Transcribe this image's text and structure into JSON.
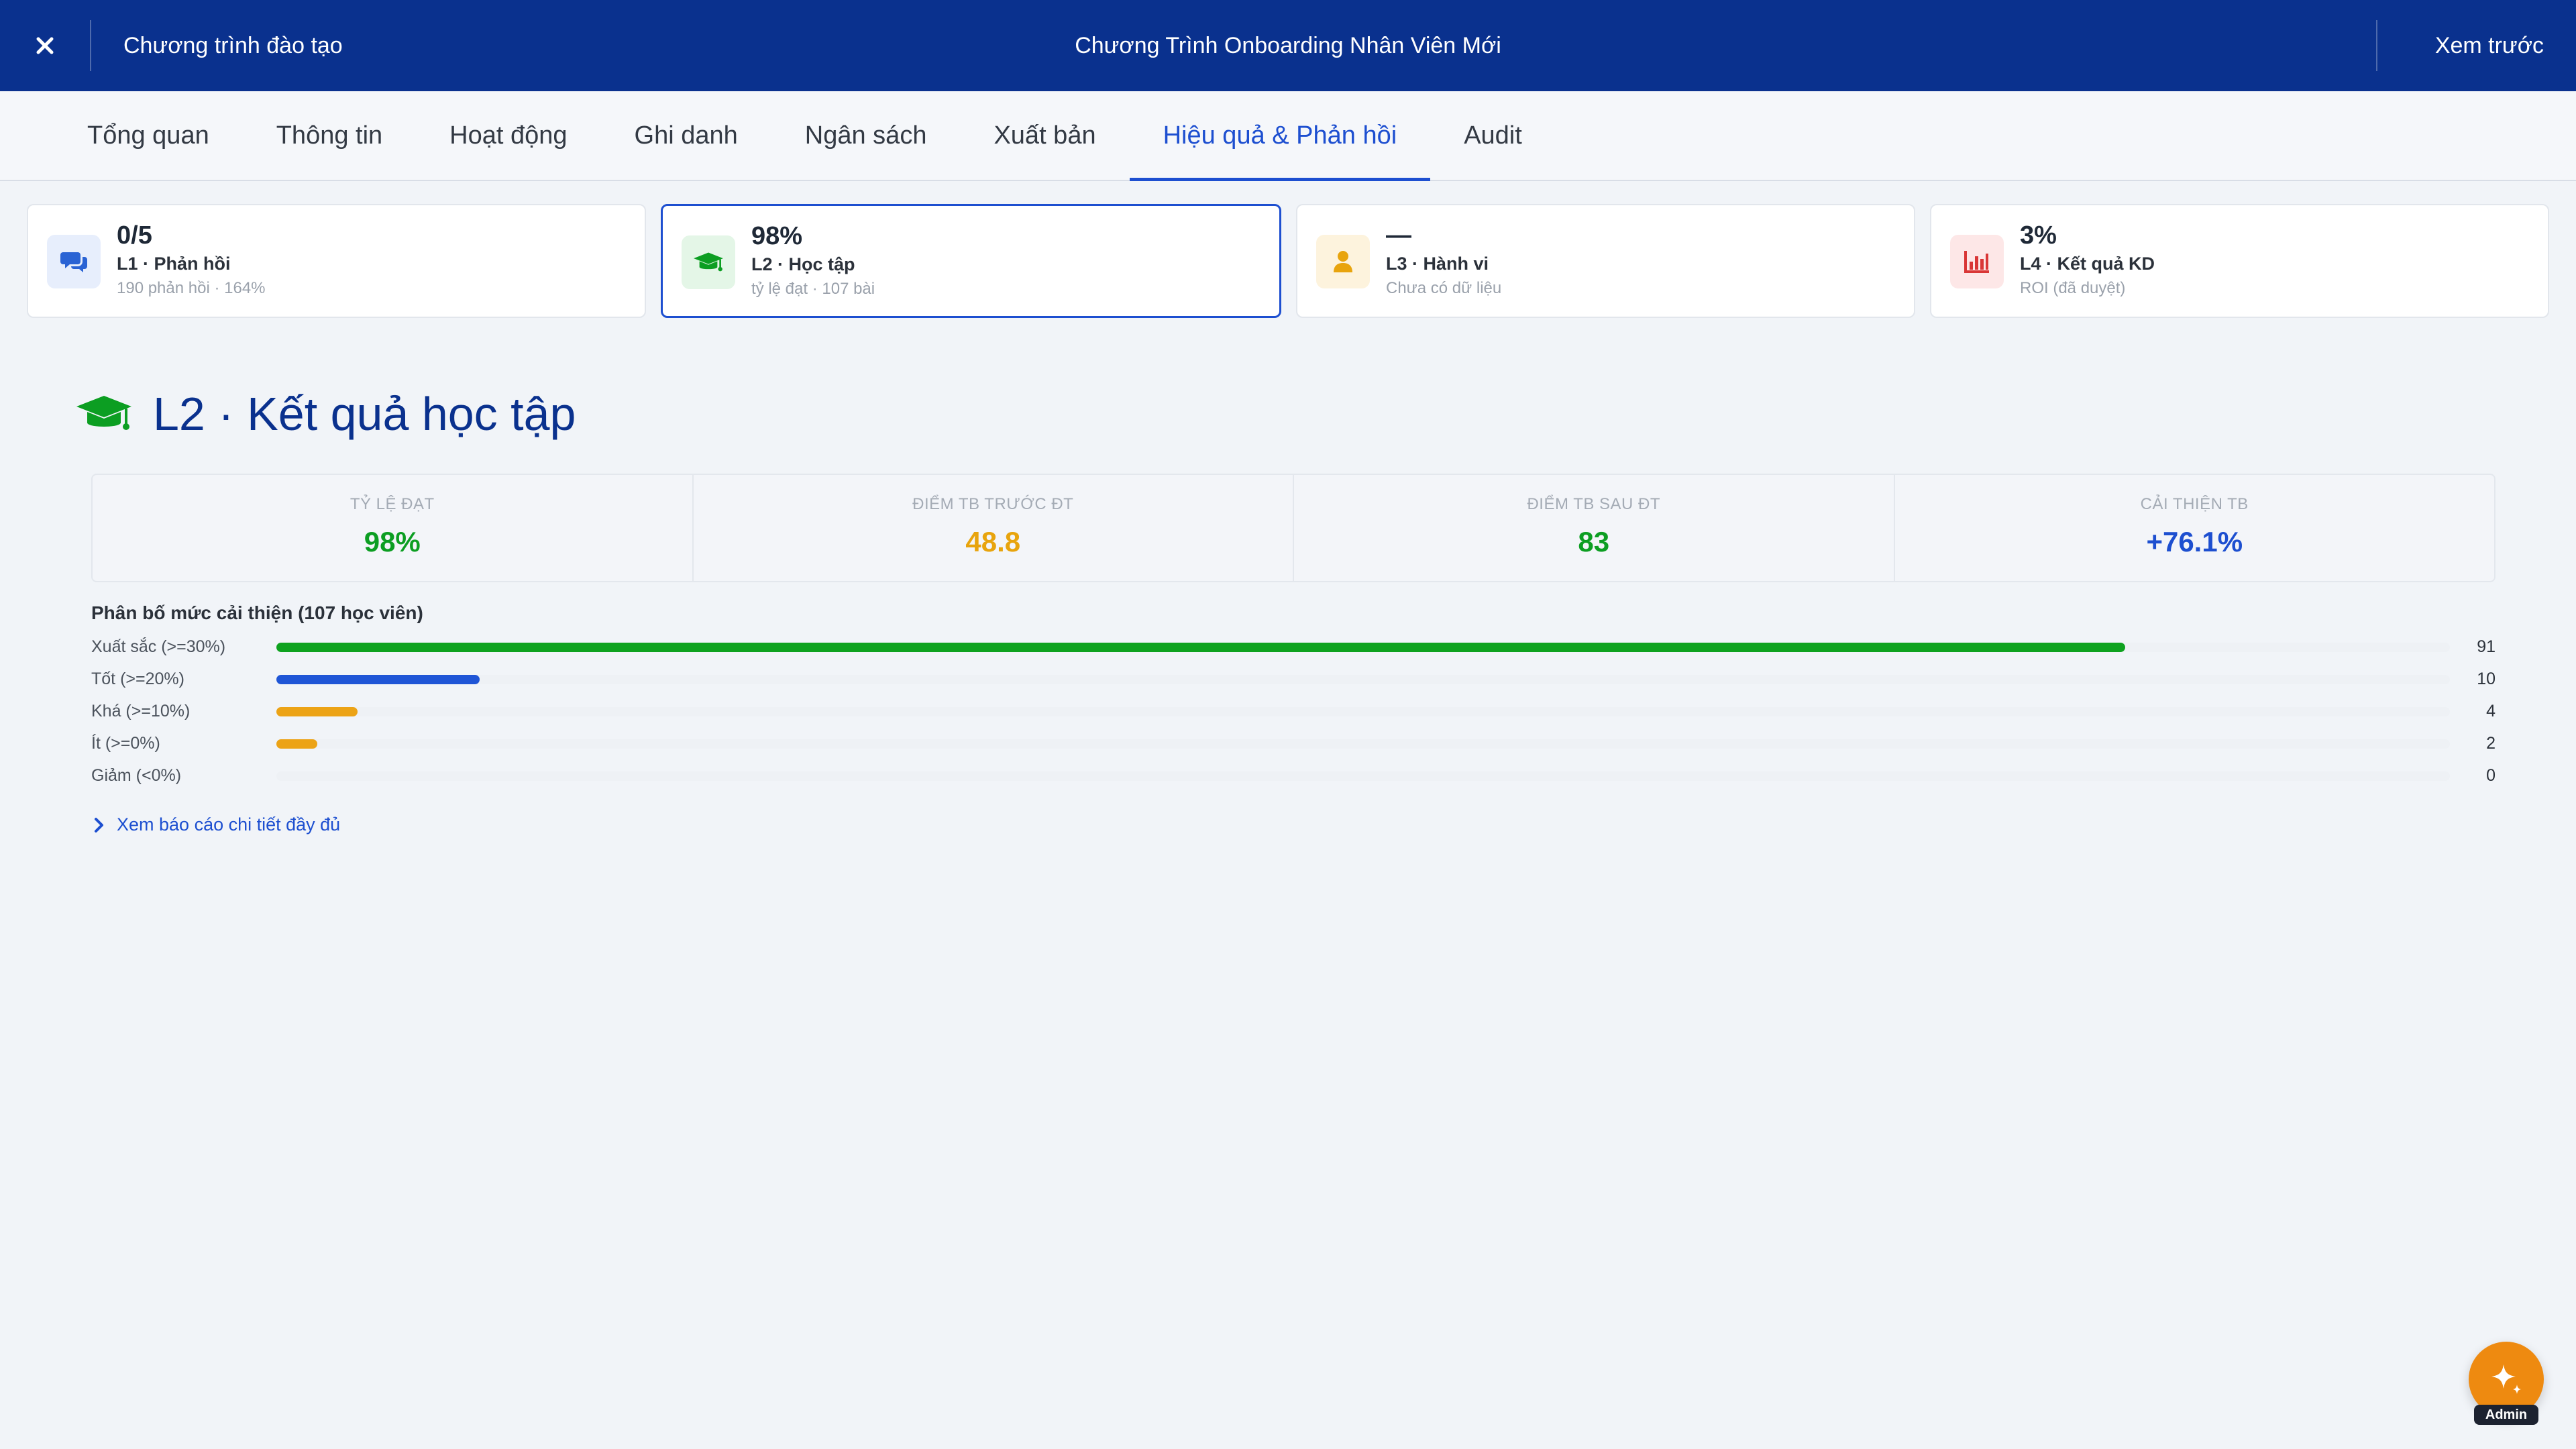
{
  "topbar": {
    "back_label": "Chương trình đào tạo",
    "title": "Chương Trình Onboarding Nhân Viên Mới",
    "preview_label": "Xem trước"
  },
  "tabs": [
    {
      "label": "Tổng quan"
    },
    {
      "label": "Thông tin"
    },
    {
      "label": "Hoạt động"
    },
    {
      "label": "Ghi danh"
    },
    {
      "label": "Ngân sách"
    },
    {
      "label": "Xuất bản"
    },
    {
      "label": "Hiệu quả & Phản hồi",
      "active": true
    },
    {
      "label": "Audit"
    }
  ],
  "kpis": [
    {
      "value": "0/5",
      "label": "L1 · Phản hồi",
      "sub": "190 phản hồi · 164%",
      "icon": "chat-icon",
      "color": "#2a63d4",
      "bg": "#e7eefc"
    },
    {
      "value": "98%",
      "label": "L2 · Học tập",
      "sub": "tỷ lệ đạt · 107 bài",
      "icon": "graduation-cap-icon",
      "color": "#0c9e22",
      "bg": "#e4f6e7",
      "selected": true
    },
    {
      "value": "—",
      "label": "L3 · Hành vi",
      "sub": "Chưa có dữ liệu",
      "icon": "user-icon",
      "color": "#e8a40d",
      "bg": "#fdf3dd"
    },
    {
      "value": "3%",
      "label": "L4 · Kết quả KD",
      "sub": "ROI (đã duyệt)",
      "icon": "bar-chart-icon",
      "color": "#d93636",
      "bg": "#fde7e7"
    }
  ],
  "section": {
    "title": "L2 · Kết quả học tập",
    "icon": "graduation-cap-icon"
  },
  "stats": [
    {
      "label": "TỶ LỆ ĐẠT",
      "value": "98%",
      "color": "#0c9e22"
    },
    {
      "label": "ĐIỂM TB TRƯỚC ĐT",
      "value": "48.8",
      "color": "#e8a40d"
    },
    {
      "label": "ĐIỂM TB SAU ĐT",
      "value": "83",
      "color": "#0c9e22"
    },
    {
      "label": "CẢI THIỆN TB",
      "value": "+76.1%",
      "color": "#1d4fd0"
    }
  ],
  "distribution": {
    "title": "Phân bố mức cải thiện (107 học viên)",
    "max": 107,
    "rows": [
      {
        "label": "Xuất sắc (>=30%)",
        "count": 91,
        "color": "#0ea21f"
      },
      {
        "label": "Tốt (>=20%)",
        "count": 10,
        "color": "#1f55d6"
      },
      {
        "label": "Khá (>=10%)",
        "count": 4,
        "color": "#eca316"
      },
      {
        "label": "Ít (>=0%)",
        "count": 2,
        "color": "#eca316"
      },
      {
        "label": "Giảm (<0%)",
        "count": 0,
        "color": "#e03c3c"
      }
    ]
  },
  "report_link": {
    "label": "Xem báo cáo chi tiết đầy đủ",
    "icon": "chevron-right-icon"
  },
  "fab": {
    "badge": "Admin",
    "icon": "sparkle-icon"
  }
}
